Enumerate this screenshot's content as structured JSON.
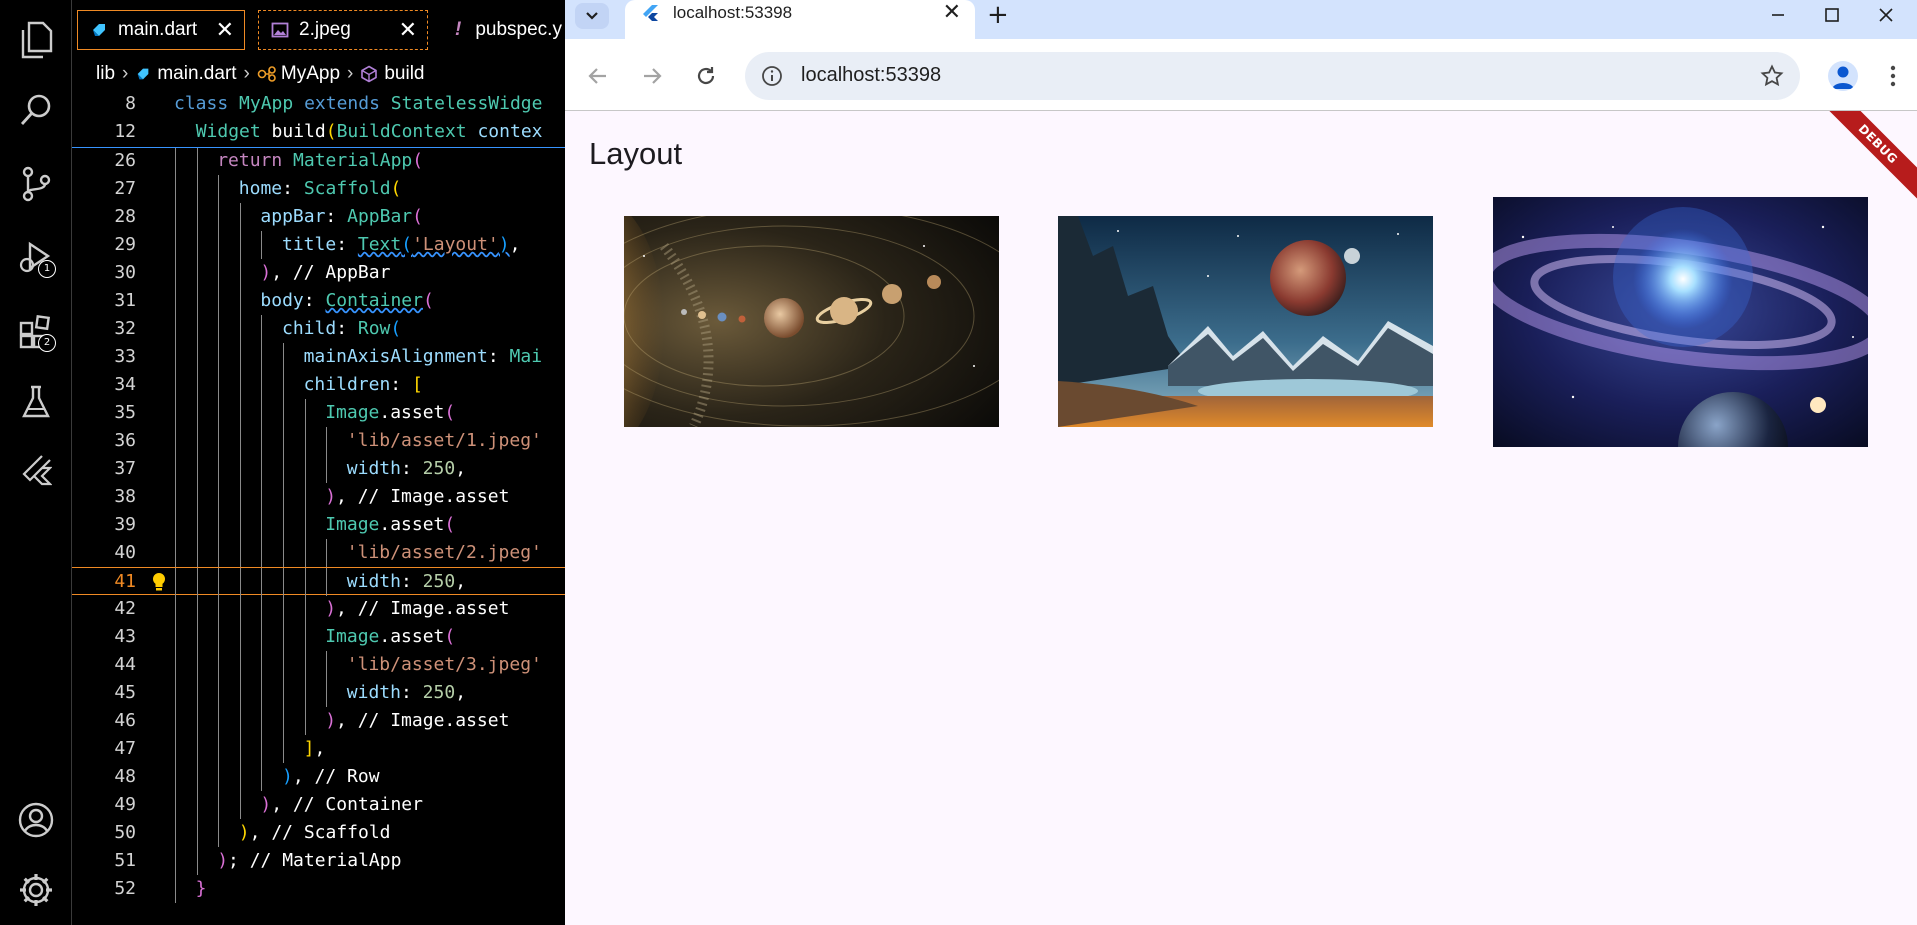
{
  "editor": {
    "tabs": [
      {
        "label": "main.dart",
        "icon": "dart-file-icon"
      },
      {
        "label": "2.jpeg",
        "icon": "image-file-icon"
      },
      {
        "label": "pubspec.y",
        "icon": "yaml-file-icon"
      }
    ],
    "breadcrumb": [
      "lib",
      "main.dart",
      "MyApp",
      "build"
    ],
    "activity_bar": {
      "badges": {
        "run_debug": "1",
        "extensions": "2"
      }
    },
    "sticky_lines": [
      {
        "num": "8",
        "segments": [
          {
            "t": "class ",
            "c": "kw"
          },
          {
            "t": "MyApp ",
            "c": "ty"
          },
          {
            "t": "extends ",
            "c": "kw"
          },
          {
            "t": "StatelessWidge",
            "c": "ty"
          }
        ]
      },
      {
        "num": "12",
        "segments": [
          {
            "t": "  ",
            "c": "w"
          },
          {
            "t": "Widget ",
            "c": "ty"
          },
          {
            "t": "build",
            "c": "w"
          },
          {
            "t": "(",
            "c": "b1"
          },
          {
            "t": "BuildContext ",
            "c": "ty"
          },
          {
            "t": "contex",
            "c": "p"
          }
        ]
      }
    ],
    "lines": [
      {
        "num": "26",
        "segments": [
          {
            "t": "return ",
            "c": "k"
          },
          {
            "t": "MaterialApp",
            "c": "ty"
          },
          {
            "t": "(",
            "c": "b2"
          }
        ]
      },
      {
        "num": "27",
        "segments": [
          {
            "t": "home",
            "c": "p"
          },
          {
            "t": ": ",
            "c": "w"
          },
          {
            "t": "Scaffold",
            "c": "ty"
          },
          {
            "t": "(",
            "c": "b1"
          }
        ]
      },
      {
        "num": "28",
        "segments": [
          {
            "t": "appBar",
            "c": "p"
          },
          {
            "t": ": ",
            "c": "w"
          },
          {
            "t": "AppBar",
            "c": "ty"
          },
          {
            "t": "(",
            "c": "b2"
          }
        ]
      },
      {
        "num": "29",
        "segments": [
          {
            "t": "title",
            "c": "p"
          },
          {
            "t": ": ",
            "c": "w"
          },
          {
            "t": "Text",
            "c": "ty wavy"
          },
          {
            "t": "(",
            "c": "b3 wavy"
          },
          {
            "t": "'Layout'",
            "c": "s wavy"
          },
          {
            "t": ")",
            "c": "b3 wavy"
          },
          {
            "t": ",",
            "c": "w"
          }
        ]
      },
      {
        "num": "30",
        "segments": [
          {
            "t": ")",
            "c": "b2"
          },
          {
            "t": ", // AppBar",
            "c": "w"
          }
        ]
      },
      {
        "num": "31",
        "segments": [
          {
            "t": "body",
            "c": "p"
          },
          {
            "t": ": ",
            "c": "w"
          },
          {
            "t": "Container",
            "c": "ty wavy"
          },
          {
            "t": "(",
            "c": "b2"
          }
        ]
      },
      {
        "num": "32",
        "segments": [
          {
            "t": "child",
            "c": "p"
          },
          {
            "t": ": ",
            "c": "w"
          },
          {
            "t": "Row",
            "c": "ty"
          },
          {
            "t": "(",
            "c": "b3"
          }
        ]
      },
      {
        "num": "33",
        "segments": [
          {
            "t": "mainAxisAlignment",
            "c": "p"
          },
          {
            "t": ": ",
            "c": "w"
          },
          {
            "t": "Mai",
            "c": "ty"
          }
        ]
      },
      {
        "num": "34",
        "segments": [
          {
            "t": "children",
            "c": "p"
          },
          {
            "t": ": ",
            "c": "w"
          },
          {
            "t": "[",
            "c": "b1"
          }
        ]
      },
      {
        "num": "35",
        "segments": [
          {
            "t": "Image",
            "c": "ty"
          },
          {
            "t": ".asset",
            "c": "w"
          },
          {
            "t": "(",
            "c": "b2"
          }
        ]
      },
      {
        "num": "36",
        "segments": [
          {
            "t": "'lib/asset/1.jpeg'",
            "c": "s"
          }
        ]
      },
      {
        "num": "37",
        "segments": [
          {
            "t": "width",
            "c": "p"
          },
          {
            "t": ": ",
            "c": "w"
          },
          {
            "t": "250",
            "c": "n"
          },
          {
            "t": ",",
            "c": "w"
          }
        ]
      },
      {
        "num": "38",
        "segments": [
          {
            "t": ")",
            "c": "b2"
          },
          {
            "t": ", // Image.asset",
            "c": "w"
          }
        ]
      },
      {
        "num": "39",
        "segments": [
          {
            "t": "Image",
            "c": "ty"
          },
          {
            "t": ".asset",
            "c": "w"
          },
          {
            "t": "(",
            "c": "b2"
          }
        ]
      },
      {
        "num": "40",
        "segments": [
          {
            "t": "'lib/asset/2.jpeg'",
            "c": "s"
          }
        ]
      },
      {
        "num": "41",
        "segments": [
          {
            "t": "width",
            "c": "p"
          },
          {
            "t": ": ",
            "c": "w"
          },
          {
            "t": "250",
            "c": "n"
          },
          {
            "t": ",",
            "c": "w"
          }
        ],
        "active": true
      },
      {
        "num": "42",
        "segments": [
          {
            "t": ")",
            "c": "b2"
          },
          {
            "t": ", // Image.asset",
            "c": "w"
          }
        ]
      },
      {
        "num": "43",
        "segments": [
          {
            "t": "Image",
            "c": "ty"
          },
          {
            "t": ".asset",
            "c": "w"
          },
          {
            "t": "(",
            "c": "b2"
          }
        ]
      },
      {
        "num": "44",
        "segments": [
          {
            "t": "'lib/asset/3.jpeg'",
            "c": "s"
          }
        ]
      },
      {
        "num": "45",
        "segments": [
          {
            "t": "width",
            "c": "p"
          },
          {
            "t": ": ",
            "c": "w"
          },
          {
            "t": "250",
            "c": "n"
          },
          {
            "t": ",",
            "c": "w"
          }
        ]
      },
      {
        "num": "46",
        "segments": [
          {
            "t": ")",
            "c": "b2"
          },
          {
            "t": ", // Image.asset",
            "c": "w"
          }
        ]
      },
      {
        "num": "47",
        "segments": [
          {
            "t": "]",
            "c": "b1"
          },
          {
            "t": ",",
            "c": "w"
          }
        ]
      },
      {
        "num": "48",
        "segments": [
          {
            "t": ")",
            "c": "b3"
          },
          {
            "t": ", // Row",
            "c": "w"
          }
        ]
      },
      {
        "num": "49",
        "segments": [
          {
            "t": ")",
            "c": "b2"
          },
          {
            "t": ", // Container",
            "c": "w"
          }
        ]
      },
      {
        "num": "50",
        "segments": [
          {
            "t": ")",
            "c": "b1"
          },
          {
            "t": ", // Scaffold",
            "c": "w"
          }
        ]
      },
      {
        "num": "51",
        "segments": [
          {
            "t": ")",
            "c": "b2"
          },
          {
            "t": "; // MaterialApp",
            "c": "w"
          }
        ]
      },
      {
        "num": "52",
        "segments": [
          {
            "t": "}",
            "c": "b2"
          }
        ]
      }
    ]
  },
  "browser": {
    "tab_title": "localhost:53398",
    "url": "localhost:53398",
    "colors": {
      "frame": "#d3e3fd",
      "omnibox": "#e9eef6",
      "page_bg": "#fdf7ff"
    }
  },
  "app": {
    "appbar_title": "Layout",
    "debug_banner": "DEBUG",
    "images": [
      {
        "alt": "solar-system-image"
      },
      {
        "alt": "alien-landscape-image"
      },
      {
        "alt": "galaxy-image"
      }
    ]
  }
}
